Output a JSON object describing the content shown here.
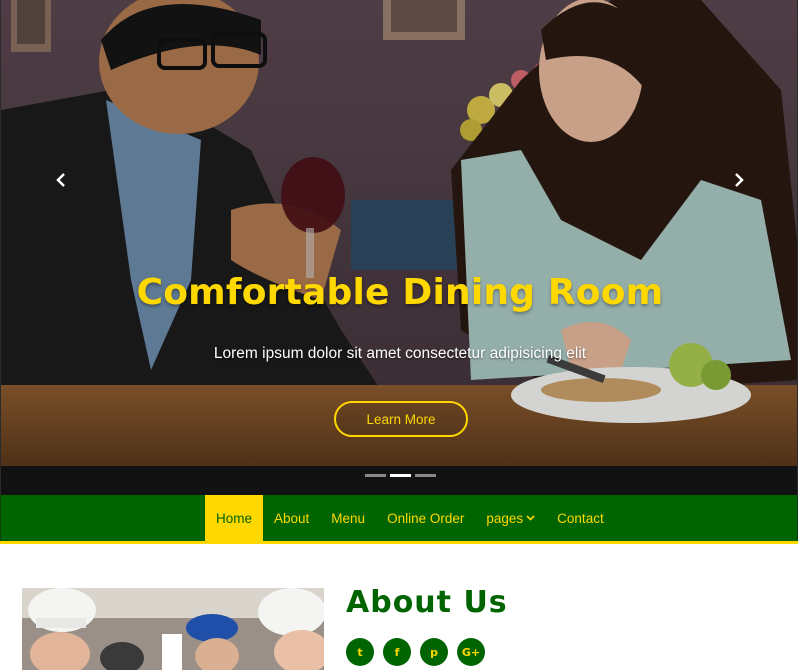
{
  "hero": {
    "title": "Comfortable Dining Room",
    "subtitle": "Lorem ipsum dolor sit amet consectetur adipisicing elit",
    "button_label": "Learn More",
    "active_slide": 2,
    "slide_count": 3
  },
  "nav": {
    "items": [
      {
        "label": "Home",
        "active": true
      },
      {
        "label": "About",
        "active": false
      },
      {
        "label": "Menu",
        "active": false
      },
      {
        "label": "Online Order",
        "active": false
      },
      {
        "label": "pages",
        "active": false,
        "dropdown": true
      },
      {
        "label": "Contact",
        "active": false
      }
    ]
  },
  "about": {
    "title": "About Us",
    "social_icons": [
      "twitter-icon",
      "facebook-icon",
      "pinterest-icon",
      "google-plus-icon"
    ],
    "social_glyphs": [
      "t",
      "f",
      "p",
      "G+"
    ]
  },
  "colors": {
    "brand_green": "#006400",
    "accent_yellow": "#ffd800",
    "white": "#ffffff"
  }
}
